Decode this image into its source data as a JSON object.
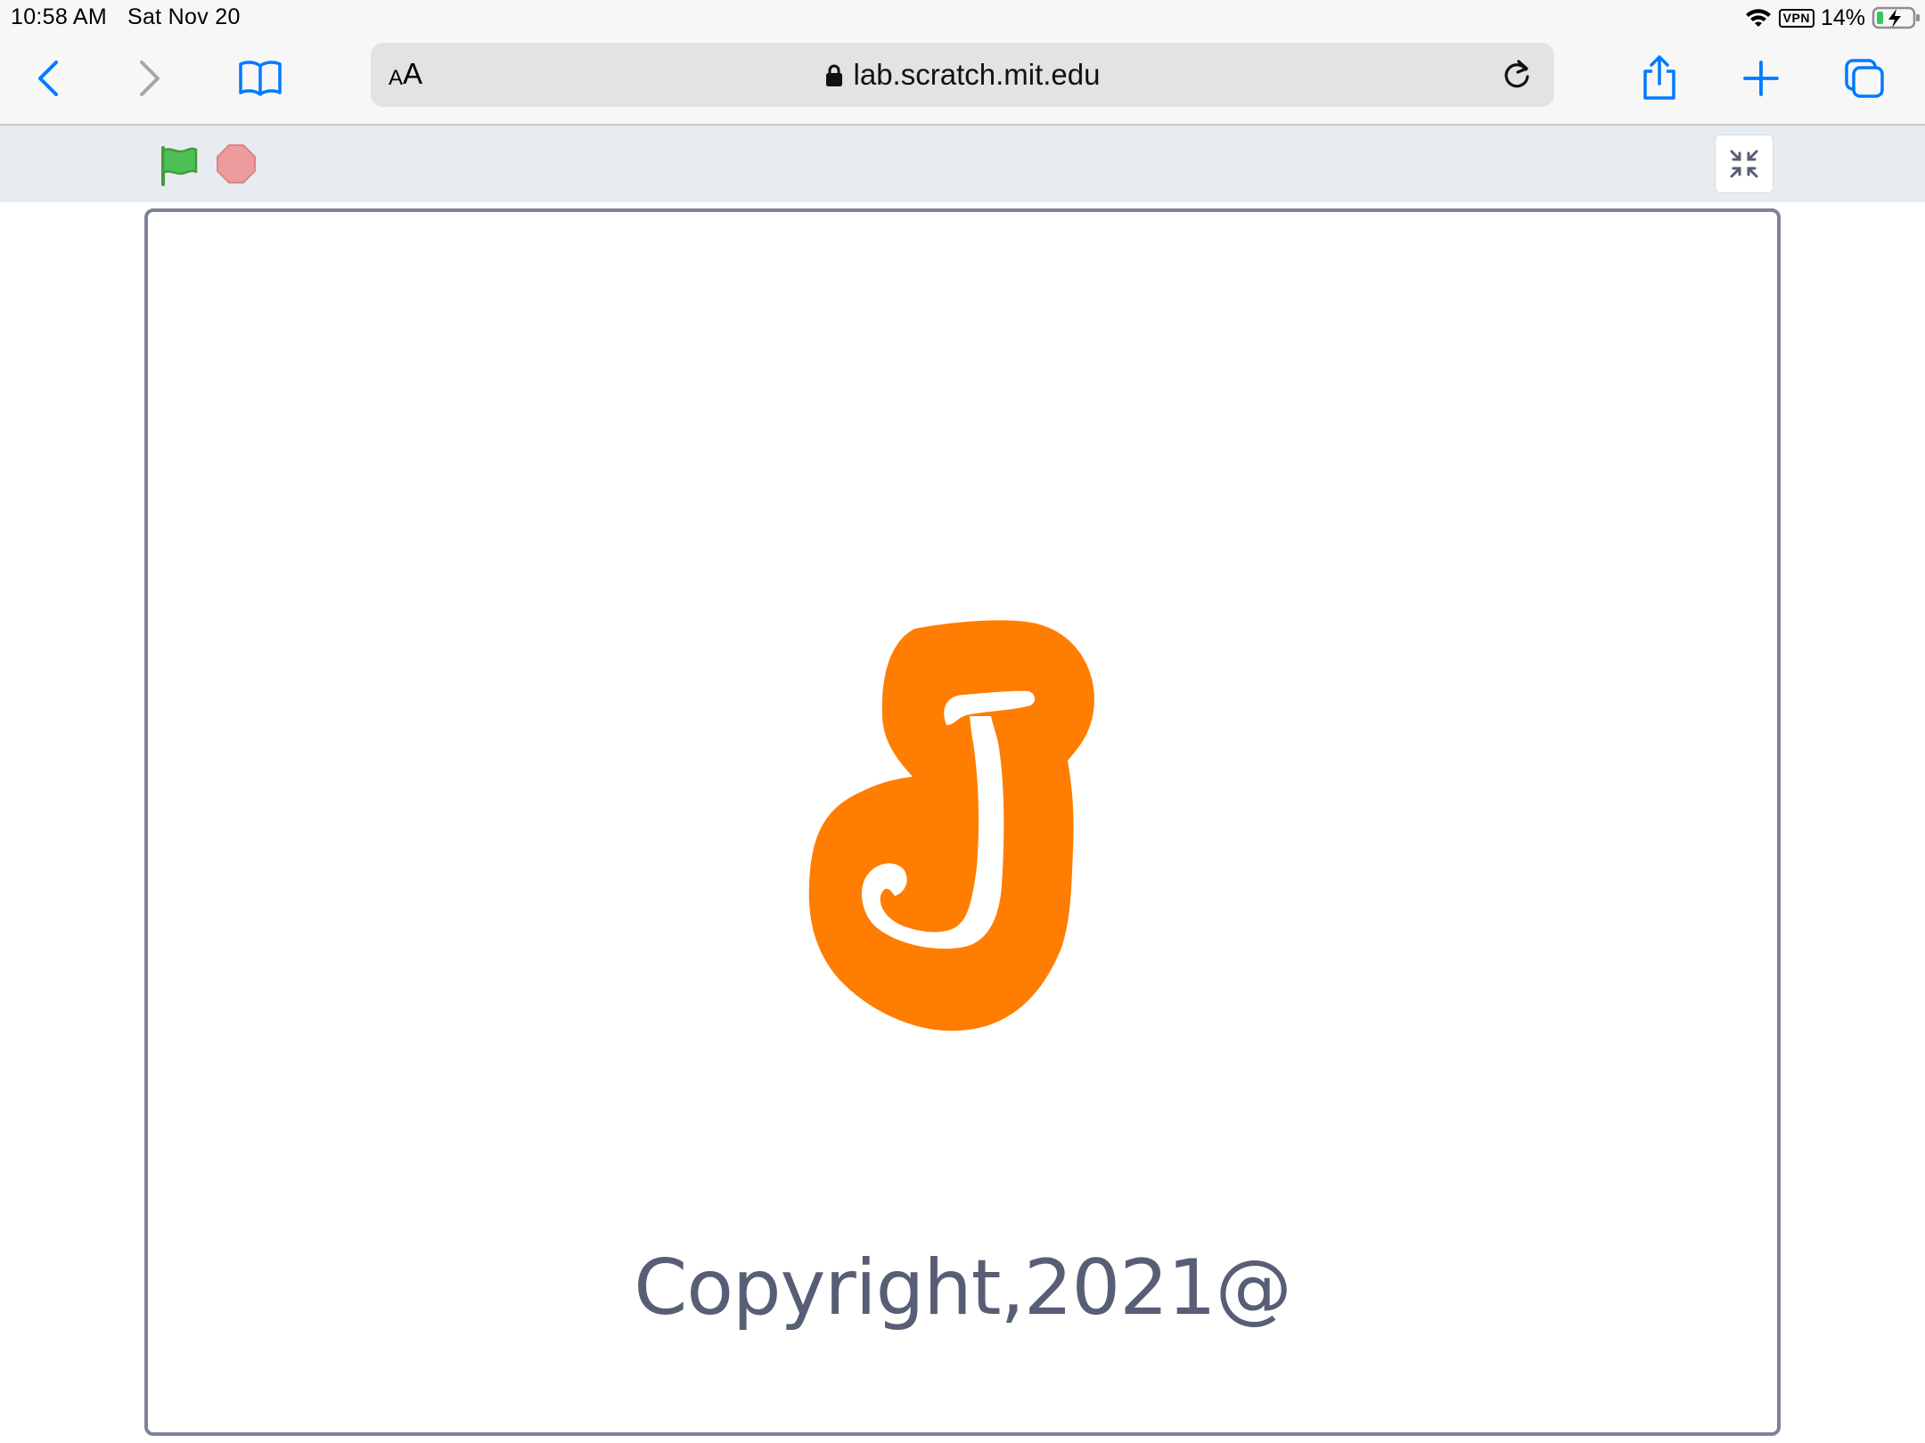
{
  "status_bar": {
    "time": "10:58 AM",
    "date": "Sat Nov 20",
    "vpn": "VPN",
    "battery_percent": "14%",
    "battery_level": 0.14,
    "charging": true
  },
  "browser": {
    "text_size_small": "A",
    "text_size_large": "A",
    "url": "lab.scratch.mit.edu",
    "accent_color": "#007aff",
    "icons": [
      "back-icon",
      "forward-icon",
      "bookmarks-icon",
      "lock-icon",
      "reload-icon",
      "share-icon",
      "new-tab-icon",
      "tabs-icon"
    ]
  },
  "player": {
    "icons": [
      "green-flag-icon",
      "stop-icon",
      "unfullscreen-icon"
    ],
    "flag_color": "#4cbf56",
    "stop_color": "#ec9c9c"
  },
  "stage": {
    "copyright": "Copyright,2021@",
    "sprite_letter": "J",
    "sprite_color": "#ff7d00",
    "border_color": "#7d8396",
    "text_color": "#575e75"
  }
}
